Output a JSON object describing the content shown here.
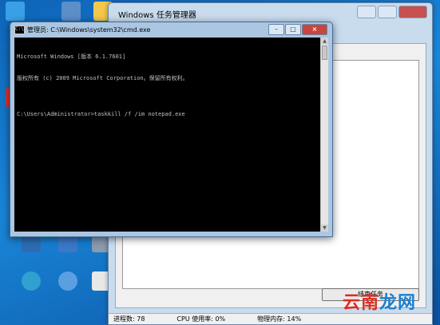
{
  "task_manager": {
    "title": "Windows 任务管理器",
    "end_task_label": "结束任务",
    "status": {
      "processes": "进程数: 78",
      "cpu": "CPU 使用率: 0%",
      "memory": "物理内存: 14%"
    }
  },
  "cmd": {
    "title": "管理员: C:\\Windows\\system32\\cmd.exe",
    "lines": [
      "Microsoft Windows [版本 6.1.7601]",
      "版权所有 (c) 2009 Microsoft Corporation。保留所有权利。",
      "",
      "C:\\Users\\Administrator>taskkill /f /im notepad.exe"
    ]
  },
  "watermark": {
    "part1": "云南",
    "part2": "龙网"
  },
  "colors": {
    "console_bg": "#000000",
    "console_fg": "#c0c0c0",
    "desktop": "#1a86d8"
  }
}
